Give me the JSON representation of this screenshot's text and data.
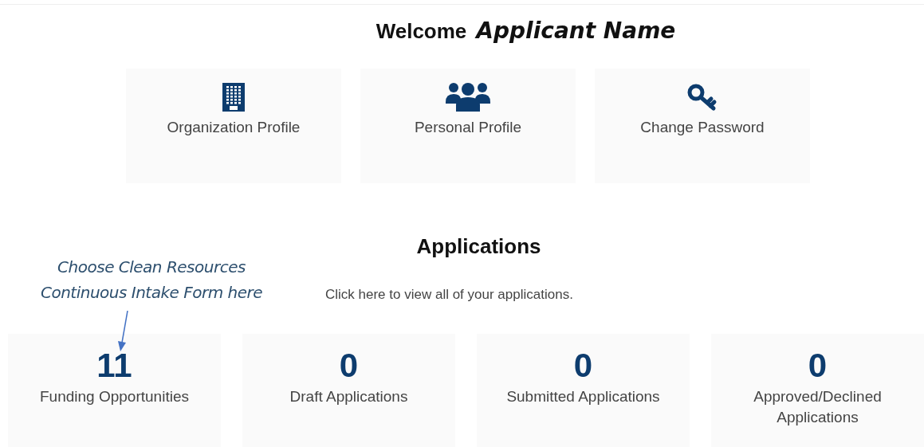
{
  "welcome": {
    "greeting": "Welcome",
    "name": "Applicant Name"
  },
  "profile_cards": [
    {
      "kind": "building",
      "label": "Organization Profile"
    },
    {
      "kind": "people",
      "label": "Personal Profile"
    },
    {
      "kind": "key",
      "label": "Change Password"
    }
  ],
  "applications": {
    "title": "Applications",
    "link": "Click here to view all of your applications.",
    "annotation": [
      "Choose Clean Resources",
      "Continuous Intake Form here"
    ],
    "stats": [
      {
        "count": "11",
        "label": "Funding Opportunities"
      },
      {
        "count": "0",
        "label": "Draft Applications"
      },
      {
        "count": "0",
        "label": "Submitted Applications"
      },
      {
        "count": "0",
        "label": "Approved/Declined Applications"
      }
    ]
  }
}
